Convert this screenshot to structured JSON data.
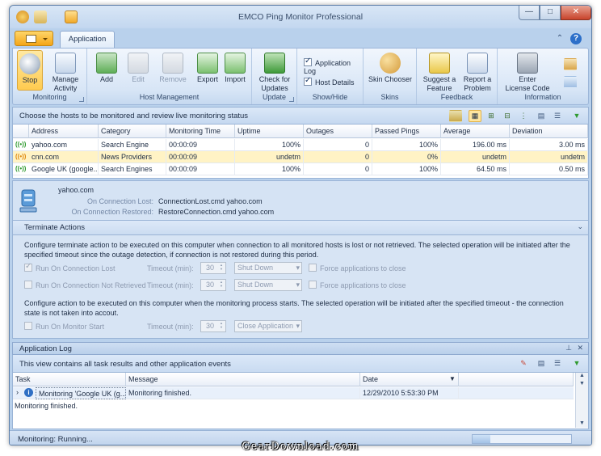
{
  "window": {
    "title": "EMCO Ping Monitor Professional",
    "controls": {
      "minimize": "—",
      "maximize": "□",
      "close": "✕"
    }
  },
  "ribbon": {
    "tab": "Application",
    "groups": {
      "monitoring": {
        "label": "Monitoring",
        "stop": "Stop",
        "manage_activity": "Manage Activity",
        "manage_activity_line1": "Manage",
        "manage_activity_line2": "Activity"
      },
      "host_management": {
        "label": "Host Management",
        "add": "Add",
        "edit": "Edit",
        "remove": "Remove",
        "export": "Export",
        "import": "Import"
      },
      "update": {
        "label": "Update",
        "check_line1": "Check for",
        "check_line2": "Updates"
      },
      "show_hide": {
        "label": "Show/Hide",
        "application_log": "Application Log",
        "host_details": "Host Details",
        "application_log_checked": true,
        "host_details_checked": true
      },
      "skins": {
        "label": "Skins",
        "skin_chooser": "Skin Chooser"
      },
      "feedback": {
        "label": "Feedback",
        "suggest_line1": "Suggest a",
        "suggest_line2": "Feature",
        "report_line1": "Report a",
        "report_line2": "Problem"
      },
      "information": {
        "label": "Information",
        "enter_line1": "Enter",
        "enter_line2": "License Code"
      }
    }
  },
  "hosts_panel": {
    "header": "Choose the hosts to be monitored and review live monitoring status",
    "columns": [
      "Address",
      "Category",
      "Monitoring Time",
      "Uptime",
      "Outages",
      "Passed Pings",
      "Average",
      "Deviation"
    ],
    "rows": [
      {
        "address": "yahoo.com",
        "category": "Search Engine",
        "time": "00:00:09",
        "uptime": "100%",
        "outages": "0",
        "passed": "100%",
        "average": "196.00 ms",
        "deviation": "3.00 ms",
        "status_color": "#2f9a2f"
      },
      {
        "address": "cnn.com",
        "category": "News Providers",
        "time": "00:00:09",
        "uptime": "undetm",
        "outages": "0",
        "passed": "0%",
        "average": "undetm",
        "deviation": "undetm",
        "status_color": "#e08a10"
      },
      {
        "address": "Google UK (google...",
        "category": "Search Engines",
        "time": "00:00:09",
        "uptime": "100%",
        "outages": "0",
        "passed": "100%",
        "average": "64.50 ms",
        "deviation": "0.50 ms",
        "status_color": "#2f9a2f"
      }
    ]
  },
  "host_details": {
    "host": "yahoo.com",
    "on_lost_label": "On Connection Lost:",
    "on_lost_value": "ConnectionLost.cmd yahoo.com",
    "on_restored_label": "On Connection Restored:",
    "on_restored_value": "RestoreConnection.cmd yahoo.com"
  },
  "terminate_actions": {
    "title": "Terminate Actions",
    "desc1": "Configure terminate action to be executed on this computer when connection to all monitored hosts is lost or not retrieved. The selected operation will be initiated after the specified timeout since the outage detection, if connection is not restored during this period.",
    "row1": {
      "label": "Run On Connection Lost",
      "checked": true,
      "timeout_label": "Timeout (min):",
      "timeout": "30",
      "action": "Shut Down",
      "force": "Force applications to close"
    },
    "row2": {
      "label": "Run On Connection Not Retrieved",
      "checked": false,
      "timeout_label": "Timeout (min):",
      "timeout": "30",
      "action": "Shut Down",
      "force": "Force applications to close"
    },
    "desc2": "Configure action to be executed on this computer when the monitoring process starts. The selected operation will be initiated after the specified timeout - the connection state is not taken into accout.",
    "row3": {
      "label": "Run On Monitor Start",
      "checked": false,
      "timeout_label": "Timeout (min):",
      "timeout": "30",
      "action": "Close Application"
    }
  },
  "app_log": {
    "title": "Application Log",
    "subheader": "This view contains all task results and other application events",
    "columns": {
      "task": "Task",
      "message": "Message",
      "date": "Date"
    },
    "row": {
      "task": "Monitoring 'Google UK (g...",
      "message": "Monitoring finished.",
      "date": "12/29/2010 5:53:30 PM"
    },
    "detail": "Monitoring finished."
  },
  "status": {
    "text": "Monitoring: Running..."
  },
  "watermark": "GearDownload.com"
}
